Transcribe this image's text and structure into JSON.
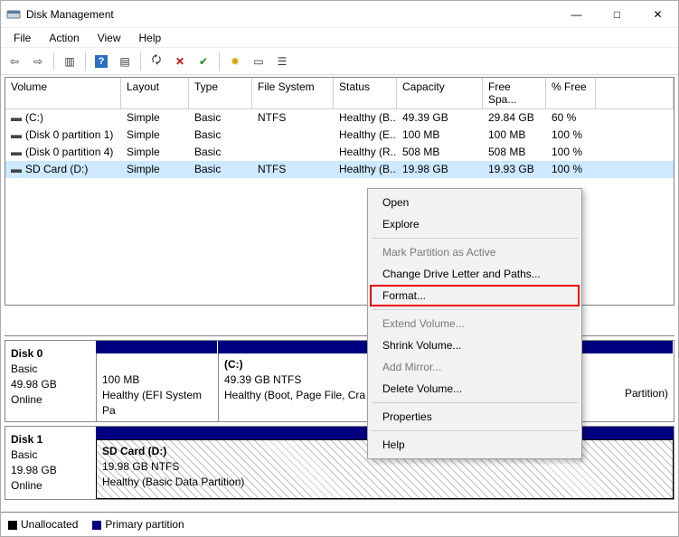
{
  "title": "Disk Management",
  "window_buttons": {
    "min": "—",
    "max": "□",
    "close": "✕"
  },
  "menubar": {
    "file": "File",
    "action": "Action",
    "view": "View",
    "help": "Help"
  },
  "volume_headers": {
    "volume": "Volume",
    "layout": "Layout",
    "type": "Type",
    "fs": "File System",
    "status": "Status",
    "capacity": "Capacity",
    "free": "Free Spa...",
    "pfree": "% Free"
  },
  "volumes": [
    {
      "name": "(C:)",
      "layout": "Simple",
      "type": "Basic",
      "fs": "NTFS",
      "status": "Healthy (B...",
      "capacity": "49.39 GB",
      "free": "29.84 GB",
      "pfree": "60 %",
      "selected": false
    },
    {
      "name": "(Disk 0 partition 1)",
      "layout": "Simple",
      "type": "Basic",
      "fs": "",
      "status": "Healthy (E...",
      "capacity": "100 MB",
      "free": "100 MB",
      "pfree": "100 %",
      "selected": false
    },
    {
      "name": "(Disk 0 partition 4)",
      "layout": "Simple",
      "type": "Basic",
      "fs": "",
      "status": "Healthy (R...",
      "capacity": "508 MB",
      "free": "508 MB",
      "pfree": "100 %",
      "selected": false
    },
    {
      "name": "SD Card (D:)",
      "layout": "Simple",
      "type": "Basic",
      "fs": "NTFS",
      "status": "Healthy (B...",
      "capacity": "19.98 GB",
      "free": "19.93 GB",
      "pfree": "100 %",
      "selected": true
    }
  ],
  "disks": {
    "d0": {
      "title": "Disk 0",
      "type": "Basic",
      "size": "49.98 GB",
      "state": "Online",
      "part0": {
        "title": "",
        "line2": "100 MB",
        "line3": "Healthy (EFI System Pa"
      },
      "part1": {
        "title": "(C:)",
        "line2": "49.39 GB NTFS",
        "line3": "Healthy (Boot, Page File, Cra"
      },
      "part2": {
        "title": "",
        "line2": "",
        "line3": "Partition)"
      }
    },
    "d1": {
      "title": "Disk 1",
      "type": "Basic",
      "size": "19.98 GB",
      "state": "Online",
      "part0": {
        "title": "SD Card  (D:)",
        "line2": "19.98 GB NTFS",
        "line3": "Healthy (Basic Data Partition)"
      }
    }
  },
  "legend": {
    "unallocated": "Unallocated",
    "primary": "Primary partition"
  },
  "context_menu": {
    "open": "Open",
    "explore": "Explore",
    "mark_active": "Mark Partition as Active",
    "change_letter": "Change Drive Letter and Paths...",
    "format": "Format...",
    "extend": "Extend Volume...",
    "shrink": "Shrink Volume...",
    "add_mirror": "Add Mirror...",
    "delete": "Delete Volume...",
    "properties": "Properties",
    "help": "Help"
  }
}
